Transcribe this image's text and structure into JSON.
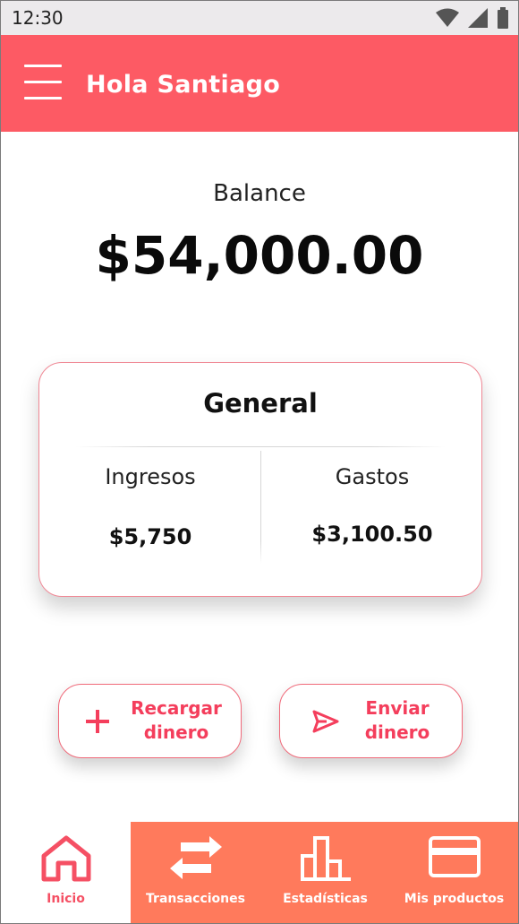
{
  "status_bar": {
    "time": "12:30"
  },
  "header": {
    "greeting": "Hola Santiago"
  },
  "balance": {
    "label": "Balance",
    "amount": "$54,000.00"
  },
  "summary_card": {
    "title": "General",
    "income": {
      "label": "Ingresos",
      "value": "$5,750"
    },
    "expenses": {
      "label": "Gastos",
      "value": "$3,100.50"
    }
  },
  "actions": [
    {
      "label_line1": "Recargar",
      "label_line2": "dinero",
      "icon": "plus-icon"
    },
    {
      "label_line1": "Enviar",
      "label_line2": "dinero",
      "icon": "send-icon"
    }
  ],
  "bottom_nav": [
    {
      "label": "Inicio",
      "icon": "home-icon",
      "active": true
    },
    {
      "label": "Transacciones",
      "icon": "swap-arrows-icon",
      "active": false
    },
    {
      "label": "Estadísticas",
      "icon": "bar-chart-icon",
      "active": false
    },
    {
      "label": "Mis productos",
      "icon": "credit-card-icon",
      "active": false
    }
  ],
  "colors": {
    "primary": "#fd5a64",
    "accent": "#f43e5c",
    "nav_background": "#ff7a5c",
    "status_bar": "#eceaec"
  }
}
